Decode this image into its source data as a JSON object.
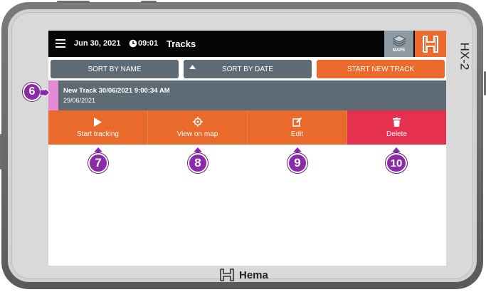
{
  "device": {
    "model": "HX-2",
    "brand": "Hema"
  },
  "topbar": {
    "date": "Jun 30, 2021",
    "time": "09:01",
    "title": "Tracks",
    "maps_label": "MAPS"
  },
  "sort_bar": {
    "sort_by_name": "SORT BY NAME",
    "sort_by_date": "SORT BY DATE",
    "start_new_track": "START NEW TRACK"
  },
  "track": {
    "name": "New Track 30/06/2021 9:00:34 AM",
    "date": "29/06/2021"
  },
  "actions": [
    {
      "label": "Start tracking",
      "icon": "play-icon"
    },
    {
      "label": "View on map",
      "icon": "crosshair-icon"
    },
    {
      "label": "Edit",
      "icon": "edit-icon"
    },
    {
      "label": "Delete",
      "icon": "trash-icon"
    }
  ],
  "callouts": {
    "track_row": "6",
    "start_tracking": "7",
    "view_on_map": "8",
    "edit": "9",
    "delete": "10"
  },
  "colors": {
    "topbar": "#050505",
    "accent_orange": "#ec6a2c",
    "slate": "#5e6b75",
    "delete_red": "#e63050",
    "track_marker": "#e58ad6",
    "callout_purple": "#8a2aa6"
  }
}
